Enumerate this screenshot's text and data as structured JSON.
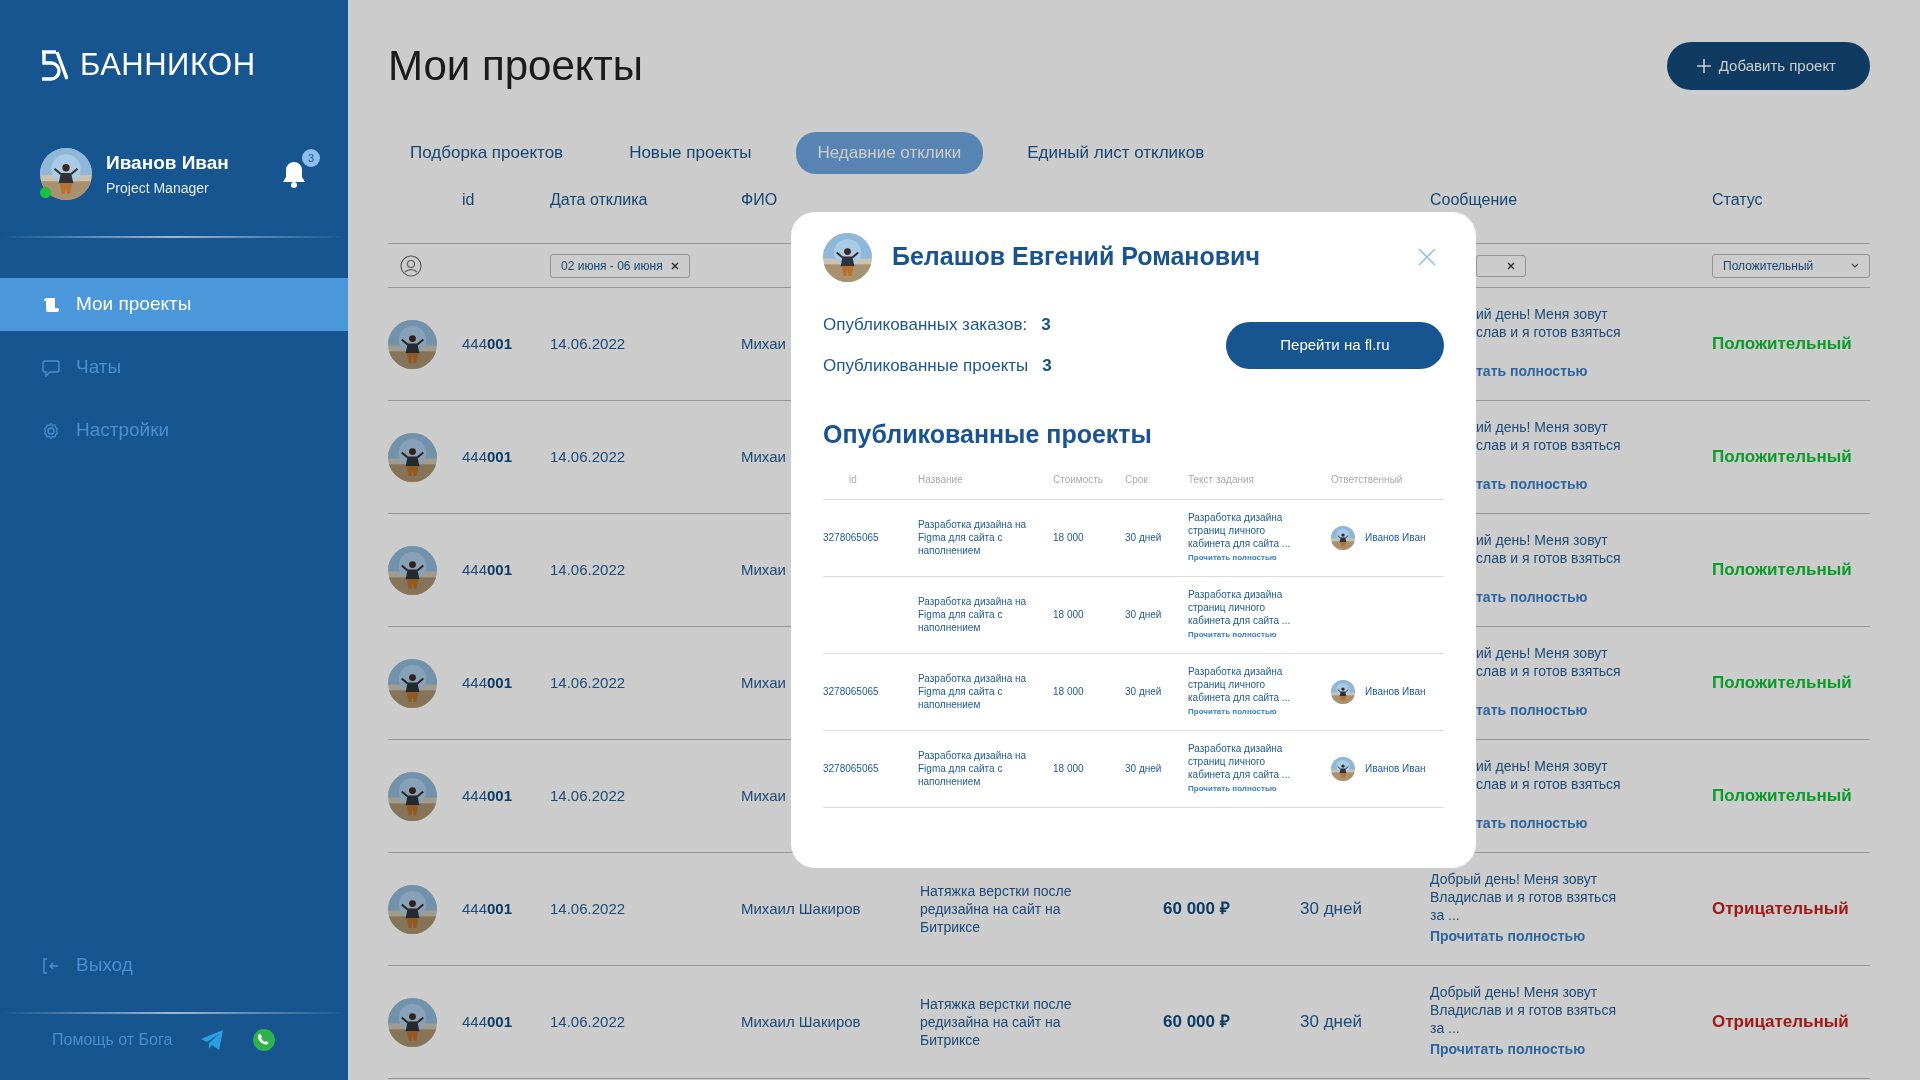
{
  "sidebar": {
    "logo": "БАННИКОН",
    "user": {
      "name": "Иванов Иван",
      "role": "Project Manager",
      "online": true
    },
    "notifications": "3",
    "menu": [
      {
        "label": "Мои проекты",
        "kind": "projects",
        "selected": true
      },
      {
        "label": "Чаты",
        "kind": "chat",
        "selected": false
      },
      {
        "label": "Настройки",
        "kind": "settings",
        "selected": false
      }
    ],
    "logout": "Выход",
    "help": "Помощь от Бога"
  },
  "page": {
    "title": "Мои проекты",
    "add_button": "Добавить проект"
  },
  "tabs": [
    {
      "label": "Подборка проектов",
      "selected": false
    },
    {
      "label": "Новые проекты",
      "selected": false
    },
    {
      "label": "Недавние отклики",
      "selected": true
    },
    {
      "label": "Единый лист откликов",
      "selected": false
    }
  ],
  "table": {
    "columns": [
      "id",
      "Дата отклика",
      "ФИО",
      "Сообщение",
      "Статус"
    ],
    "filters": {
      "date": "02 июня - 06 июня",
      "status": "Положительный"
    },
    "rows": [
      {
        "id": "444**001**",
        "date": "14.06.2022",
        "name": "Михаи",
        "message": "ий день! Меня зовут\nслав и я готов взяться",
        "read_more": "тать полностью",
        "status": "Положительный",
        "positive": true
      },
      {
        "id": "444**001**",
        "date": "14.06.2022",
        "name": "Михаи",
        "message": "ий день! Меня зовут\nслав и я готов взяться",
        "read_more": "тать полностью",
        "status": "Положительный",
        "positive": true
      },
      {
        "id": "444**001**",
        "date": "14.06.2022",
        "name": "Михаи",
        "message": "ий день! Меня зовут\nслав и я готов взяться",
        "read_more": "тать полностью",
        "status": "Положительный",
        "positive": true
      },
      {
        "id": "444**001**",
        "date": "14.06.2022",
        "name": "Михаи",
        "message": "ий день! Меня зовут\nслав и я готов взяться",
        "read_more": "тать полностью",
        "status": "Положительный",
        "positive": true
      },
      {
        "id": "444**001**",
        "date": "14.06.2022",
        "name": "Михаи",
        "message": "ий день! Меня зовут\nслав и я готов взяться",
        "read_more": "тать полностью",
        "status": "Положительный",
        "positive": true
      },
      {
        "id": "444**001**",
        "date": "14.06.2022",
        "name": "Михаил Шакиров",
        "title": "Натяжка верстки после редизайна на сайт на Битриксе",
        "price": "60 000 ₽",
        "term": "30 дней",
        "message": "Добрый день! Меня зовут\nВладислав и я готов взяться\nза ...",
        "read_more": "Прочитать полностью",
        "status": "Отрицательный",
        "positive": false
      },
      {
        "id": "444**001**",
        "date": "14.06.2022",
        "name": "Михаил Шакиров",
        "title": "Натяжка верстки после редизайна на сайт на Битриксе",
        "price": "60 000 ₽",
        "term": "30 дней",
        "message": "Добрый день! Меня зовут\nВладислав и я готов взяться\nза ...",
        "read_more": "Прочитать полностью",
        "status": "Отрицательный",
        "positive": false
      }
    ]
  },
  "modal": {
    "name": "Белашов Евгений Романович",
    "stats": [
      {
        "label": "Опубликованных заказов:",
        "value": "3"
      },
      {
        "label": "Опубликованные проекты",
        "value": "3"
      }
    ],
    "button": "Перейти на fl.ru",
    "section_title": "Опубликованные проекты",
    "columns": [
      "id",
      "Название",
      "Стоимость",
      "Срок",
      "Текст задания",
      "Ответственный"
    ],
    "rows": [
      {
        "id": "3278065065",
        "title": "Разработка дизайна на Figma для сайта с наполнением",
        "cost": "18 000",
        "term": "30 дней",
        "text": "Разработка дизайна страниц личного кабинета для сайта ...",
        "read_more": "Прочитать полностью",
        "responsible": "Иванов Иван"
      },
      {
        "title": "Разработка дизайна на Figma для сайта с наполнением",
        "cost": "18 000",
        "term": "30 дней",
        "text": "Разработка дизайна страниц личного кабинета для сайта ...",
        "read_more": "Прочитать полностью"
      },
      {
        "id": "3278065065",
        "title": "Разработка дизайна на Figma для сайта с наполнением",
        "cost": "18 000",
        "term": "30 дней",
        "text": "Разработка дизайна страниц личного кабинета для сайта ...",
        "read_more": "Прочитать полностью",
        "responsible": "Иванов Иван"
      },
      {
        "id": "3278065065",
        "title": "Разработка дизайна на Figma для сайта с наполнением",
        "cost": "18 000",
        "term": "30 дней",
        "text": "Разработка дизайна страниц личного кабинета для сайта ...",
        "read_more": "Прочитать полностью",
        "responsible": "Иванов Иван"
      }
    ]
  }
}
